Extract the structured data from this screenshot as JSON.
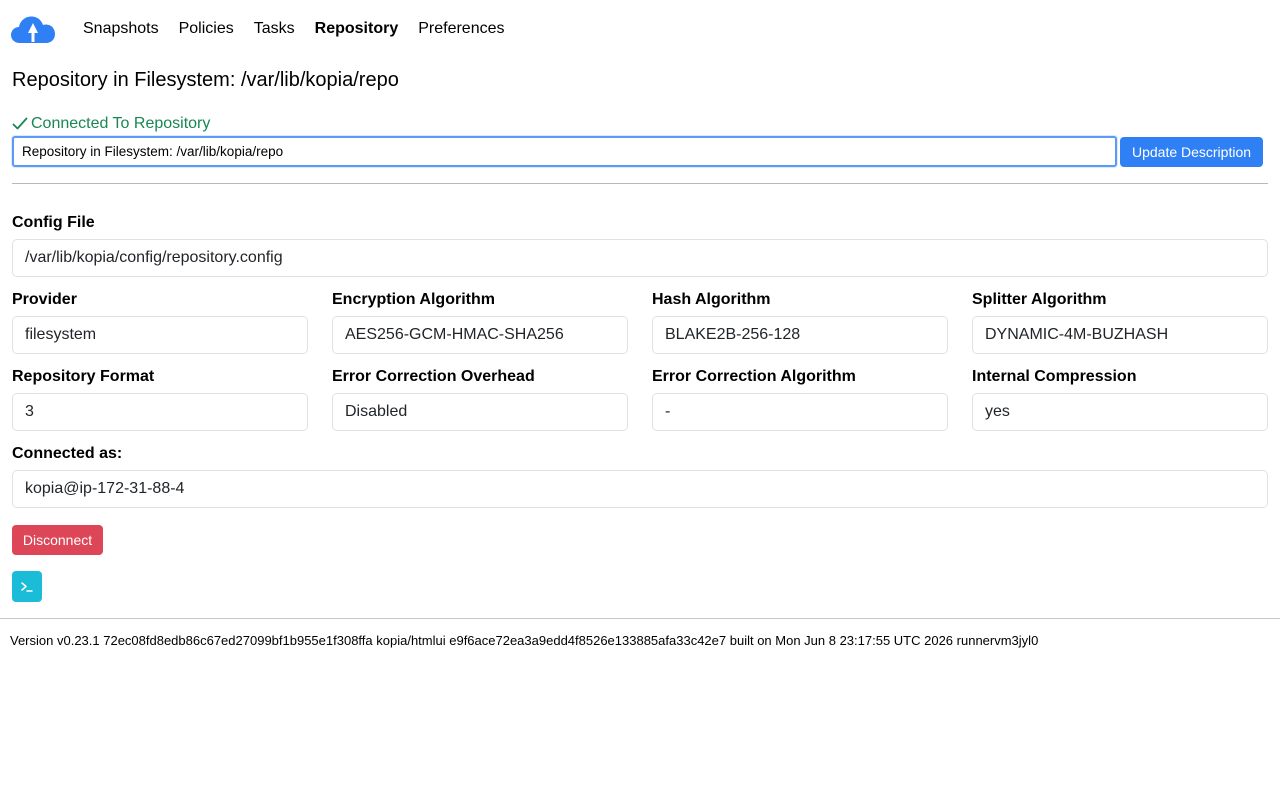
{
  "nav": {
    "items": [
      {
        "label": "Snapshots",
        "active": false
      },
      {
        "label": "Policies",
        "active": false
      },
      {
        "label": "Tasks",
        "active": false
      },
      {
        "label": "Repository",
        "active": true
      },
      {
        "label": "Preferences",
        "active": false
      }
    ]
  },
  "page": {
    "title": "Repository in Filesystem: /var/lib/kopia/repo",
    "status": "Connected To Repository"
  },
  "description": {
    "value": "Repository in Filesystem: /var/lib/kopia/repo",
    "button_label": "Update Description"
  },
  "fields": {
    "config_file": {
      "label": "Config File",
      "value": "/var/lib/kopia/config/repository.config"
    },
    "provider": {
      "label": "Provider",
      "value": "filesystem"
    },
    "encryption": {
      "label": "Encryption Algorithm",
      "value": "AES256-GCM-HMAC-SHA256"
    },
    "hash": {
      "label": "Hash Algorithm",
      "value": "BLAKE2B-256-128"
    },
    "splitter": {
      "label": "Splitter Algorithm",
      "value": "DYNAMIC-4M-BUZHASH"
    },
    "format": {
      "label": "Repository Format",
      "value": "3"
    },
    "ecc_overhead": {
      "label": "Error Correction Overhead",
      "value": "Disabled"
    },
    "ecc_algorithm": {
      "label": "Error Correction Algorithm",
      "value": "-"
    },
    "compression": {
      "label": "Internal Compression",
      "value": "yes"
    },
    "connected_as": {
      "label": "Connected as:",
      "value": "kopia@ip-172-31-88-4"
    }
  },
  "actions": {
    "disconnect_label": "Disconnect"
  },
  "footer": {
    "text": "Version v0.23.1 72ec08fd8edb86c67ed27099bf1b955e1f308ffa kopia/htmlui e9f6ace72ea3a9edd4f8526e133885afa33c42e7 built on Mon Jun 8 23:17:55 UTC 2026 runnervm3jyl0"
  },
  "colors": {
    "brand": "#2f7ff5",
    "success": "#198754",
    "danger": "#dc4656",
    "info": "#1abcd8"
  },
  "icons": {
    "logo": "kopia-cloud-logo",
    "status": "check-icon",
    "cli": "terminal-icon"
  }
}
